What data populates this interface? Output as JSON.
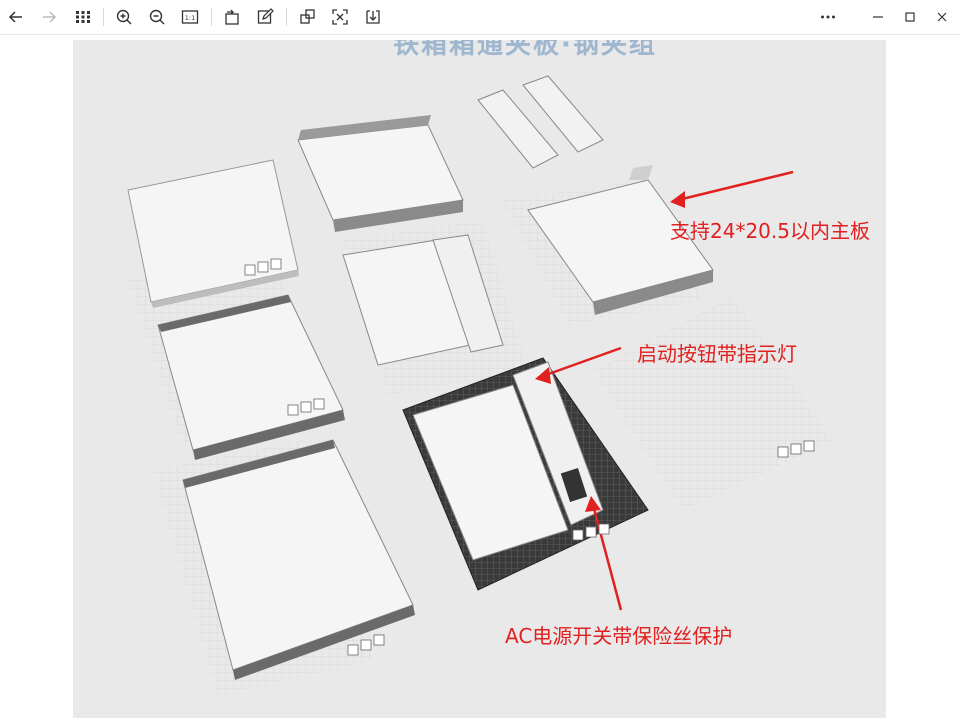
{
  "toolbar": {
    "items": [
      {
        "icon": "back-arrow-icon"
      },
      {
        "icon": "forward-arrow-icon"
      },
      {
        "icon": "grid-view-icon"
      },
      {
        "icon": "zoom-in-icon"
      },
      {
        "icon": "zoom-out-icon"
      },
      {
        "icon": "actual-size-icon"
      },
      {
        "icon": "rotate-icon"
      },
      {
        "icon": "edit-icon"
      },
      {
        "icon": "crop-icon"
      },
      {
        "icon": "fit-screen-icon"
      },
      {
        "icon": "download-icon"
      },
      {
        "icon": "more-icon"
      },
      {
        "icon": "minimize-icon"
      },
      {
        "icon": "maximize-icon"
      },
      {
        "icon": "close-icon"
      }
    ],
    "actual_size_label": "1:1"
  },
  "image": {
    "title_text": "铁箱箱通夹板·钢夹组",
    "annotations": {
      "mainboard": "支持24*20.5以内主板",
      "power_button": "启动按钮带指示灯",
      "ac_switch": "AC电源开关带保险丝保护"
    }
  },
  "colors": {
    "annotation_red": "#e12020",
    "canvas_bg": "#e9e9e9",
    "part_white": "#f7f7f7",
    "part_dark": "#555555"
  }
}
